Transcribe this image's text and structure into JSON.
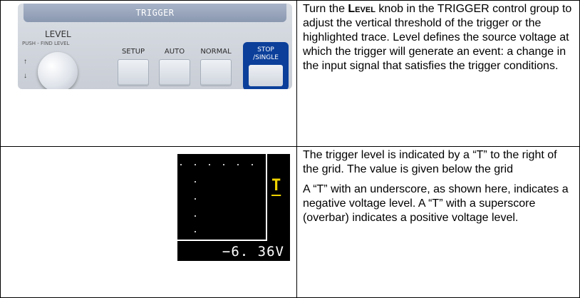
{
  "panel": {
    "group_title": "TRIGGER",
    "level_label": "LEVEL",
    "level_sublabel": "PUSH - FIND LEVEL",
    "arrow_up": "↑",
    "arrow_down": "↓",
    "buttons": [
      {
        "label": "SETUP"
      },
      {
        "label": "AUTO"
      },
      {
        "label": "NORMAL"
      }
    ],
    "stop_line1": "STOP",
    "stop_line2": "/SINGLE",
    "accent_color": "#0b3f9a"
  },
  "row1": {
    "text_before": "Turn the ",
    "level_word": "Level",
    "text_after": " knob in the TRIGGER control group to adjust the vertical threshold of the trigger or the highlighted trace. Level defines the source voltage at which the trigger will generate an event: a change in the input signal that satisfies the trigger conditions."
  },
  "scope": {
    "trigger_marker": "T",
    "voltage": "−6. 36V",
    "marker_color": "#f2d400"
  },
  "row2": {
    "para1": "The trigger level is indicated by a “T” to the right of the grid. The value is given below the grid",
    "para2": "A “T” with an underscore, as shown here, indicates a negative voltage level. A “T” with a superscore (overbar) indicates a positive voltage level."
  }
}
